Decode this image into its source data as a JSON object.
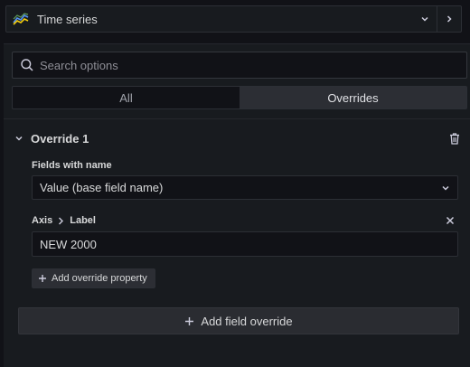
{
  "visualization": {
    "title": "Time series",
    "icon": "time-series-chart-icon"
  },
  "options": {
    "search": {
      "placeholder": "Search options",
      "value": ""
    },
    "tabs": [
      {
        "label": "All",
        "active": false
      },
      {
        "label": "Overrides",
        "active": true
      }
    ]
  },
  "override": {
    "title": "Override 1",
    "matcher": {
      "label": "Fields with name",
      "value": "Value (base field name)"
    },
    "property": {
      "category": "Axis",
      "name": "Label",
      "value": "NEW 2000"
    },
    "add_property_label": "Add override property"
  },
  "add_field_override_label": "Add field override",
  "colors": {
    "background": "#111217",
    "panel": "#181b1f",
    "border": "#2c2f35",
    "text": "#d8d9da",
    "tab_active": "#2c2e34"
  }
}
